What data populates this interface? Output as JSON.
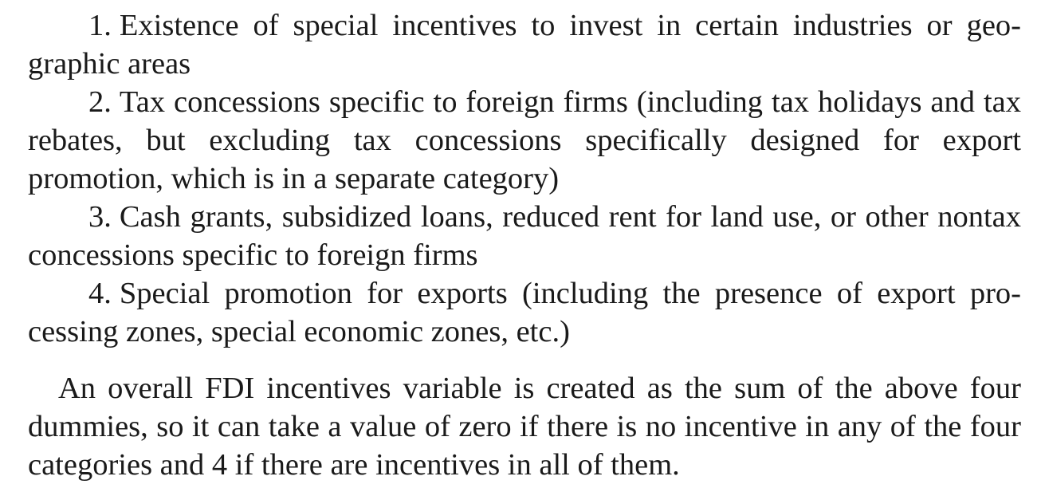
{
  "list_items": [
    {
      "number": "1.",
      "text": "Existence of special incentives to invest in certain industries or geo­graphic areas"
    },
    {
      "number": "2.",
      "text": "Tax concessions specific to foreign firms (including tax holidays and tax rebates, but excluding tax concessions specifically designed for export promotion, which is in a separate category)"
    },
    {
      "number": "3.",
      "text": "Cash grants, subsidized loans, reduced rent for land use, or other non­tax concessions specific to foreign firms"
    },
    {
      "number": "4.",
      "text": "Special promotion for exports (including the presence of export pro­cessing zones, special economic zones, etc.)"
    }
  ],
  "paragraph": "An overall FDI incentives variable is created as the sum of the above four dummies, so it can take a value of zero if there is no incentive in any of the four categories and 4 if there are incentives in all of them."
}
